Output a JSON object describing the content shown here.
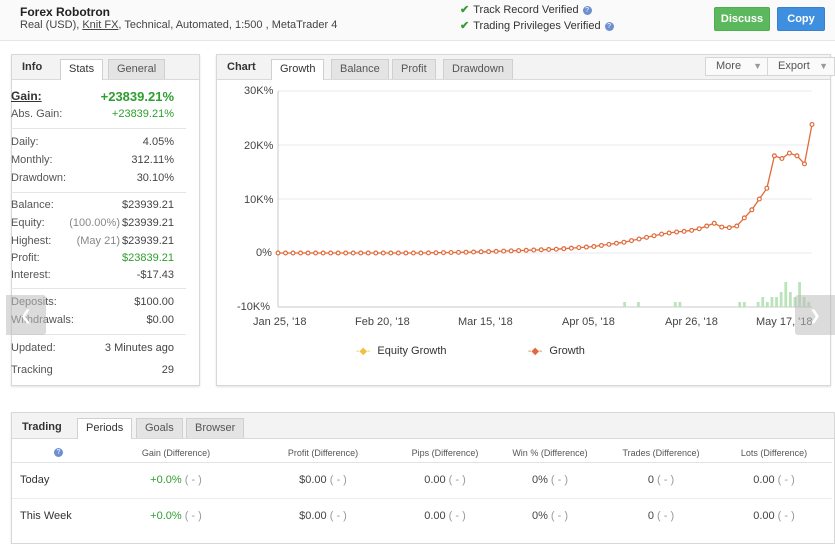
{
  "header": {
    "system_name": "Forex Robotron",
    "subtitle_prefix": "Real (USD), ",
    "broker": "Knit FX",
    "subtitle_suffix": ", Technical, Automated, 1:500 , MetaTrader 4",
    "verifications": [
      "Track Record Verified",
      "Trading Privileges Verified"
    ],
    "discuss_label": "Discuss",
    "copy_label": "Copy"
  },
  "info_panel": {
    "tabs": [
      "Info",
      "Stats",
      "General"
    ],
    "rows": {
      "gain": {
        "label": "Gain:",
        "value": "+23839.21%"
      },
      "abs_gain": {
        "label": "Abs. Gain:",
        "value": "+23839.21%"
      },
      "daily": {
        "label": "Daily:",
        "value": "4.05%"
      },
      "monthly": {
        "label": "Monthly:",
        "value": "312.11%"
      },
      "drawdown": {
        "label": "Drawdown:",
        "value": "30.10%"
      },
      "balance": {
        "label": "Balance:",
        "value": "$23939.21"
      },
      "equity": {
        "label": "Equity:",
        "prefix": "(100.00%)",
        "value": "$23939.21"
      },
      "highest": {
        "label": "Highest:",
        "prefix": "(May 21)",
        "value": "$23939.21"
      },
      "profit": {
        "label": "Profit:",
        "value": "$23839.21"
      },
      "interest": {
        "label": "Interest:",
        "value": "-$17.43"
      },
      "deposits": {
        "label": "Deposits:",
        "value": "$100.00"
      },
      "withdrawals": {
        "label": "Withdrawals:",
        "value": "$0.00"
      },
      "updated": {
        "label": "Updated:",
        "value": "3 Minutes ago"
      },
      "tracking": {
        "label": "Tracking",
        "value": "29"
      }
    }
  },
  "chart_panel": {
    "tabs": [
      "Chart",
      "Growth",
      "Balance",
      "Profit",
      "Drawdown"
    ],
    "more_label": "More",
    "export_label": "Export"
  },
  "chart_data": {
    "type": "line",
    "x_labels": [
      "Jan 25, '18",
      "Feb 20, '18",
      "Mar 15, '18",
      "Apr 05, '18",
      "Apr 26, '18",
      "May 17, '18"
    ],
    "y_ticks": [
      "30K%",
      "20K%",
      "10K%",
      "0%",
      "-10K%"
    ],
    "ylim": [
      -10000,
      30000
    ],
    "grid": true,
    "legend_position": "bottom",
    "series": [
      {
        "name": "Equity Growth",
        "color": "#f0c040",
        "values": []
      },
      {
        "name": "Growth",
        "color": "#e06a3a",
        "values": [
          0,
          0,
          0,
          0,
          0,
          0,
          0,
          0,
          0,
          0,
          0,
          0,
          0,
          0,
          0,
          0,
          0,
          0,
          0,
          0,
          20,
          50,
          80,
          100,
          120,
          150,
          180,
          220,
          250,
          300,
          350,
          400,
          450,
          500,
          550,
          600,
          650,
          700,
          800,
          900,
          1000,
          1100,
          1200,
          1400,
          1600,
          1800,
          2000,
          2300,
          2600,
          2900,
          3200,
          3500,
          3700,
          3900,
          4000,
          4200,
          4500,
          5000,
          5500,
          4800,
          4700,
          5000,
          6500,
          8000,
          10000,
          12000,
          18000,
          17500,
          18500,
          18000,
          16500,
          23800
        ]
      }
    ],
    "volume_bars": [
      0,
      0,
      0,
      0,
      0,
      0,
      0,
      0,
      0,
      0,
      0,
      0,
      0,
      0,
      0,
      0,
      0,
      0,
      0,
      0,
      0,
      0,
      0,
      0,
      0,
      0,
      0,
      0,
      0,
      0,
      0,
      0,
      0,
      0,
      0,
      0,
      0,
      0,
      0,
      0,
      0,
      0,
      0,
      0,
      0,
      0,
      0,
      0,
      0,
      0,
      0,
      0,
      0,
      0,
      0,
      0,
      0,
      0,
      0,
      0,
      0,
      0,
      0,
      0,
      0,
      0,
      0,
      0,
      0,
      0,
      0,
      0,
      0,
      0,
      0,
      1,
      0,
      0,
      1,
      0,
      0,
      0,
      0,
      0,
      0,
      0,
      1,
      1,
      0,
      0,
      0,
      0,
      0,
      0,
      0,
      0,
      0,
      0,
      0,
      0,
      1,
      1,
      0,
      0,
      1,
      2,
      1,
      2,
      2,
      3,
      5,
      3,
      2,
      5,
      2,
      1
    ]
  },
  "trading_panel": {
    "tabs": [
      "Trading",
      "Periods",
      "Goals",
      "Browser"
    ],
    "columns": [
      "Gain (Difference)",
      "Profit (Difference)",
      "Pips (Difference)",
      "Win % (Difference)",
      "Trades (Difference)",
      "Lots (Difference)"
    ],
    "rows": [
      {
        "label": "Today",
        "cells": [
          [
            "+0.0%",
            "( - )"
          ],
          [
            "$0.00",
            "( - )"
          ],
          [
            "0.00",
            "( - )"
          ],
          [
            "0%",
            "( - )"
          ],
          [
            "0",
            "( - )"
          ],
          [
            "0.00",
            "( - )"
          ]
        ]
      },
      {
        "label": "This Week",
        "cells": [
          [
            "+0.0%",
            "( - )"
          ],
          [
            "$0.00",
            "( - )"
          ],
          [
            "0.00",
            "( - )"
          ],
          [
            "0%",
            "( - )"
          ],
          [
            "0",
            "( - )"
          ],
          [
            "0.00",
            "( - )"
          ]
        ]
      }
    ]
  }
}
